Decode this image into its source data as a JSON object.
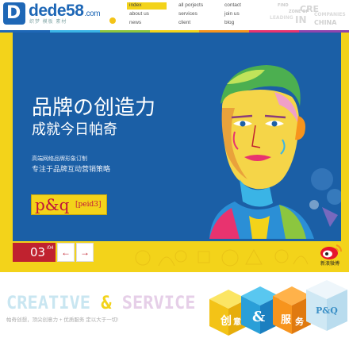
{
  "header": {
    "logo": {
      "brand": "dede58",
      "tld": ".com",
      "tagline": "织梦 模板 素材"
    },
    "nav": [
      {
        "label": "index",
        "active": true
      },
      {
        "label": "all porjects",
        "active": false
      },
      {
        "label": "contact",
        "active": false
      },
      {
        "label": "about us",
        "active": false
      },
      {
        "label": "services",
        "active": false
      },
      {
        "label": "join us",
        "active": false
      },
      {
        "label": "news",
        "active": false
      },
      {
        "label": "client",
        "active": false
      },
      {
        "label": "blog",
        "active": false
      }
    ],
    "deco_words": {
      "w1": "FIND",
      "w2": "CRE",
      "w3": "ZONE OF",
      "w4": "COMPANIES",
      "w5": "LEADING",
      "w6": "IN",
      "w7": "CHINA"
    }
  },
  "colors": {
    "brand_blue": "#1e67b6",
    "banner_blue": "#1b5fa6",
    "yellow": "#f3d31a",
    "red": "#c0222f",
    "strip": [
      "#1e67b6",
      "#3ab4e6",
      "#8cc63f",
      "#f3d31a",
      "#f7941d",
      "#e8336f",
      "#8e44ad"
    ]
  },
  "banner": {
    "slogan_main": "品牌の创造力",
    "slogan_sub": "成就今日帕奇",
    "line1": "高端网络品牌形象订制",
    "line2": "专注于品牌互动营销策略",
    "pq_mark": "p&q",
    "pq_sub": "[peid3]",
    "slide_current": "03",
    "slide_total": "/04",
    "prev_icon": "←",
    "next_icon": "→",
    "weibo_label": "新浪微博"
  },
  "bottom": {
    "creative": "CREATIVE",
    "amp": " & ",
    "service": "SERVICE",
    "tagline": "帕奇创想，顶尖创意力 + 优质服务 定以大于一切!",
    "cube_words": [
      "创",
      "意",
      "&",
      "服",
      "务",
      "P&Q"
    ]
  }
}
